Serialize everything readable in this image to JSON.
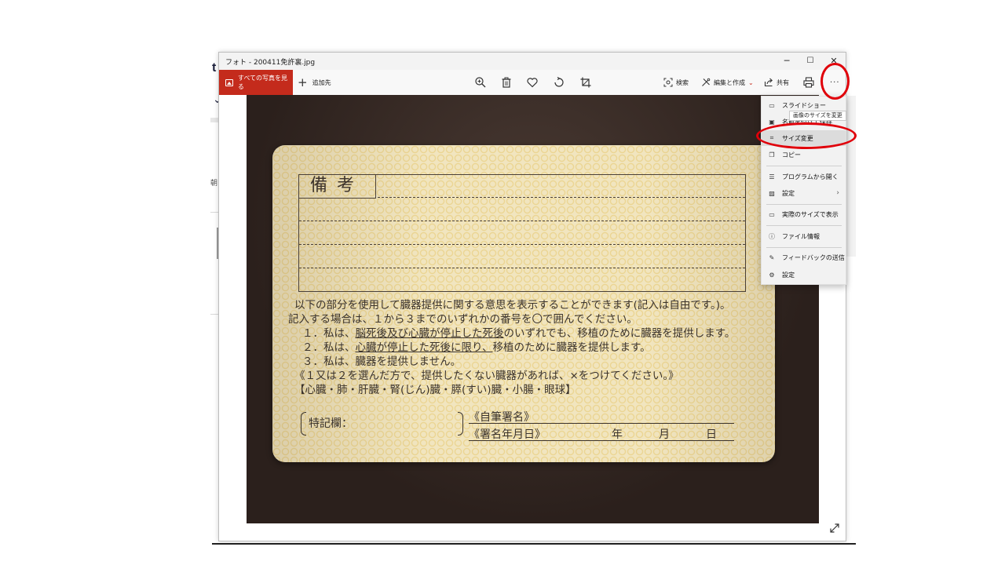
{
  "window": {
    "title": "フォト - 200411免許裏.jpg",
    "minimize_glyph": "─",
    "maximize_glyph": "☐",
    "close_glyph": "✕"
  },
  "toolbar": {
    "all_photos_label": "すべての写真を見る",
    "add_to_label": "追加先",
    "add_to_glyph": "+",
    "search_label": "検索",
    "edit_create_label": "編集と作成",
    "edit_chevron": "⌄",
    "share_label": "共有",
    "more_glyph": "···"
  },
  "background_app": {
    "fragment_t": "t",
    "fragment_chevron": "⌄",
    "fragment_char": "朝"
  },
  "photo": {
    "remarks_label": "備考",
    "lines": [
      "以下の部分を使用して臓器提供に関する意思を表示することができます(記入は自由です。)。",
      "記入する場合は、１から３までのいずれかの番号を〇で囲んでください。"
    ],
    "option1_prefix": "１．私は、",
    "option1_underlined": "脳死後及び心臓が停止した死後",
    "option1_suffix": "のいずれでも、移植のために臓器を提供します。",
    "option2_prefix": "２．私は、",
    "option2_underlined": "心臓が停止した死後に限り、",
    "option2_suffix": "移植のために臓器を提供します。",
    "option3": "３．私は、臓器を提供しません。",
    "note_line": "《１又は２を選んだ方で、提供したくない臓器があれば、×をつけてください。》",
    "organs_line": "【心臓・肺・肝臓・腎(じん)臓・膵(すい)臓・小腸・眼球】",
    "special_label": "特記欄：",
    "signature_label": "《自筆署名》",
    "date_label": "《署名年月日》",
    "year": "年",
    "month": "月",
    "day": "日"
  },
  "menu": {
    "items": [
      {
        "label": "スライドショー",
        "icon": "slideshow-icon",
        "glyph": "▭"
      },
      {
        "label": "名前を付けて保存",
        "icon": "save-icon",
        "glyph": "▣"
      },
      {
        "label": "サイズ変更",
        "icon": "resize-icon",
        "glyph": "⌗"
      },
      {
        "label": "コピー",
        "icon": "copy-icon",
        "glyph": "❐"
      },
      {
        "label": "プログラムから開く",
        "icon": "open-with-icon",
        "glyph": "☰"
      },
      {
        "label": "設定",
        "icon": "set-as-icon",
        "glyph": "▨",
        "arrow": "›"
      },
      {
        "label": "実際のサイズで表示",
        "icon": "actual-size-icon",
        "glyph": "▭"
      },
      {
        "label": "ファイル情報",
        "icon": "info-icon",
        "glyph": "ⓘ"
      },
      {
        "label": "フィードバックの送信",
        "icon": "feedback-icon",
        "glyph": "✎"
      },
      {
        "label": "設定",
        "icon": "settings-icon",
        "glyph": "⚙"
      }
    ],
    "tooltip": "画像のサイズを変更"
  },
  "colors": {
    "accent_red": "#c42b1c",
    "annotation_red": "#e0000a"
  }
}
